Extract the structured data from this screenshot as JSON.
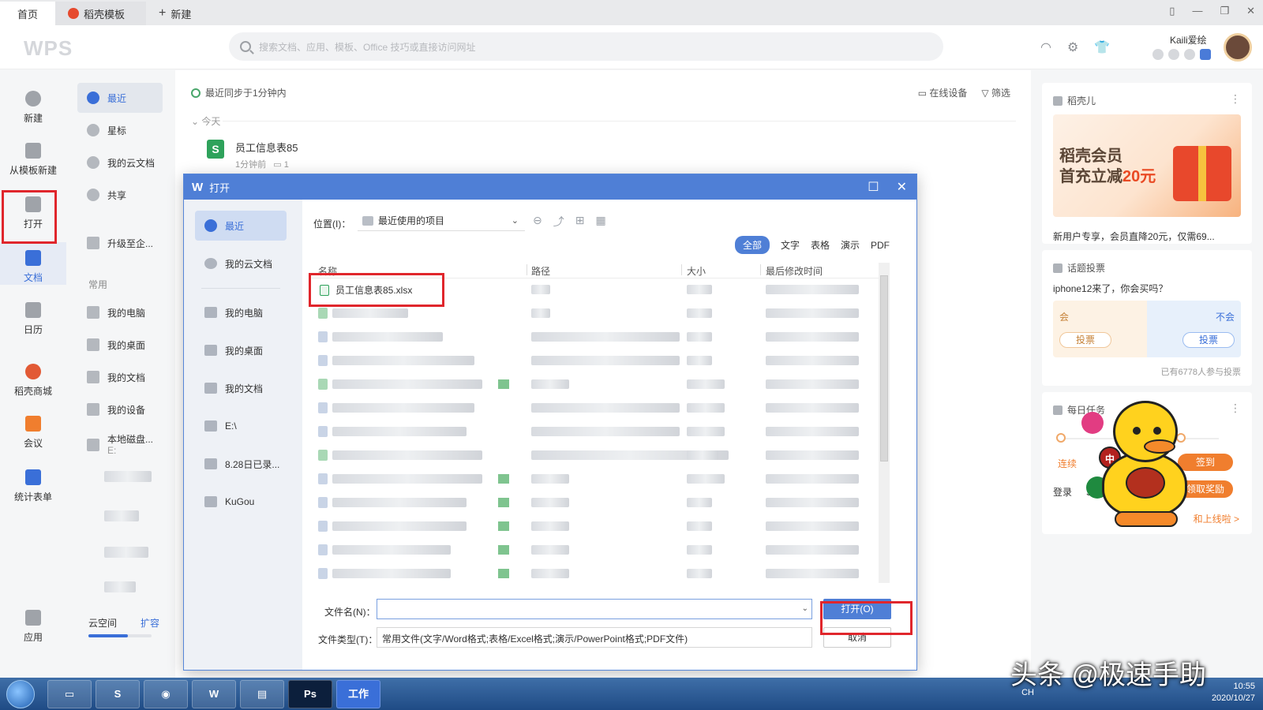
{
  "tabs": [
    {
      "label": "首页"
    },
    {
      "label": "稻壳模板"
    },
    {
      "label": "新建"
    }
  ],
  "header": {
    "logo": "WPS",
    "search_placeholder": "搜索文档、应用、模板、Office 技巧或直接访问网址",
    "username": "Kaili爱绘"
  },
  "leftnav": [
    {
      "label": "新建"
    },
    {
      "label": "从模板新建"
    },
    {
      "label": "打开"
    },
    {
      "label": "文档"
    },
    {
      "label": "日历"
    },
    {
      "label": "稻壳商城"
    },
    {
      "label": "会议"
    },
    {
      "label": "统计表单"
    },
    {
      "label": "应用"
    }
  ],
  "side2": {
    "items": [
      {
        "label": "最近"
      },
      {
        "label": "星标"
      },
      {
        "label": "我的云文档"
      },
      {
        "label": "共享"
      },
      {
        "label": "升级至企..."
      }
    ],
    "common_label": "常用",
    "common_items": [
      {
        "label": "我的电脑"
      },
      {
        "label": "我的桌面"
      },
      {
        "label": "我的文档"
      },
      {
        "label": "我的设备"
      },
      {
        "label": "本地磁盘...",
        "sub": "E:"
      }
    ],
    "cloud_label": "云空间",
    "expand_label": "扩容"
  },
  "main": {
    "sync_text": "最近同步于1分钟内",
    "online_devices": "在线设备",
    "filter": "筛选",
    "today": "今天",
    "file": {
      "name": "员工信息表85",
      "time": "1分钟前",
      "comments": "1",
      "icon_letter": "S"
    }
  },
  "right": {
    "card1": {
      "title": "稻壳儿",
      "promo_line1": "稻壳会员",
      "promo_line2_a": "首充立减",
      "promo_line2_b": "20元",
      "desc": "新用户专享，会员直降20元，仅需69..."
    },
    "card2": {
      "title": "话题投票",
      "question": "iphone12来了，你会买吗？",
      "yes": "会",
      "no": "不会",
      "vote_btn": "投票",
      "count": "已有6778人参与投票"
    },
    "card3": {
      "title": "每日任务",
      "t1": "连续",
      "t2": "签到",
      "t3": "登录",
      "t4": "S题",
      "t5": "领取奖励",
      "t6": "和上线啦 >",
      "badge": "中"
    }
  },
  "dialog": {
    "title": "打开",
    "side": [
      {
        "label": "最近"
      },
      {
        "label": "我的云文档"
      },
      {
        "label": "我的电脑"
      },
      {
        "label": "我的桌面"
      },
      {
        "label": "我的文档"
      },
      {
        "label": "E:\\"
      },
      {
        "label": "8.28日已录..."
      },
      {
        "label": "KuGou"
      }
    ],
    "location_label": "位置(I)：",
    "location_value": "最近使用的项目",
    "filters": [
      "全部",
      "文字",
      "表格",
      "演示",
      "PDF"
    ],
    "columns": [
      "名称",
      "路径",
      "大小",
      "最后修改时间"
    ],
    "first_file": "员工信息表85.xlsx",
    "filename_label": "文件名(N)：",
    "filetype_label": "文件类型(T)：",
    "filetype_value": "常用文件(文字/Word格式;表格/Excel格式;演示/PowerPoint格式;PDF文件)",
    "open_btn": "打开(O)",
    "cancel_btn": "取消"
  },
  "taskbar": {
    "work_app": "工作",
    "ps_app": "Ps",
    "lang": "CH",
    "time": "10:55",
    "date": "2020/10/27"
  },
  "watermark": "头条 @极速手助",
  "colors": {
    "accent": "#4f7fd6",
    "highlight_box": "#e0262c",
    "excel_green": "#2ea25b"
  }
}
